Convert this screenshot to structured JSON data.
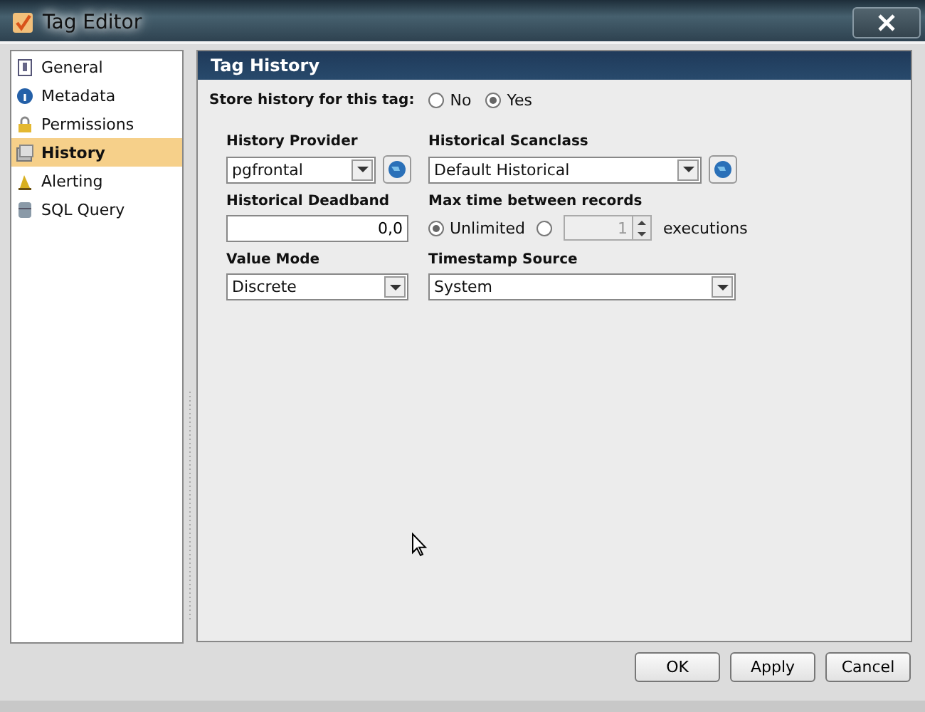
{
  "window": {
    "title": "Tag Editor"
  },
  "sidebar": {
    "items": [
      {
        "label": "General",
        "selected": false
      },
      {
        "label": "Metadata",
        "selected": false
      },
      {
        "label": "Permissions",
        "selected": false
      },
      {
        "label": "History",
        "selected": true
      },
      {
        "label": "Alerting",
        "selected": false
      },
      {
        "label": "SQL Query",
        "selected": false
      }
    ]
  },
  "panel": {
    "title": "Tag History",
    "store_history": {
      "label": "Store history for this tag:",
      "options": [
        {
          "label": "No",
          "selected": false
        },
        {
          "label": "Yes",
          "selected": true
        }
      ]
    },
    "history_provider": {
      "label": "History Provider",
      "value": "pgfrontal"
    },
    "historical_scanclass": {
      "label": "Historical Scanclass",
      "value": "Default Historical"
    },
    "historical_deadband": {
      "label": "Historical Deadband",
      "value": "0,0"
    },
    "max_time": {
      "label": "Max time between records",
      "options": [
        {
          "label": "Unlimited",
          "selected": true
        },
        {
          "selected": false
        }
      ],
      "count": "1",
      "count_disabled": true,
      "unit": "executions"
    },
    "value_mode": {
      "label": "Value Mode",
      "value": "Discrete"
    },
    "timestamp_source": {
      "label": "Timestamp Source",
      "value": "System"
    }
  },
  "buttons": [
    "OK",
    "Apply",
    "Cancel"
  ]
}
